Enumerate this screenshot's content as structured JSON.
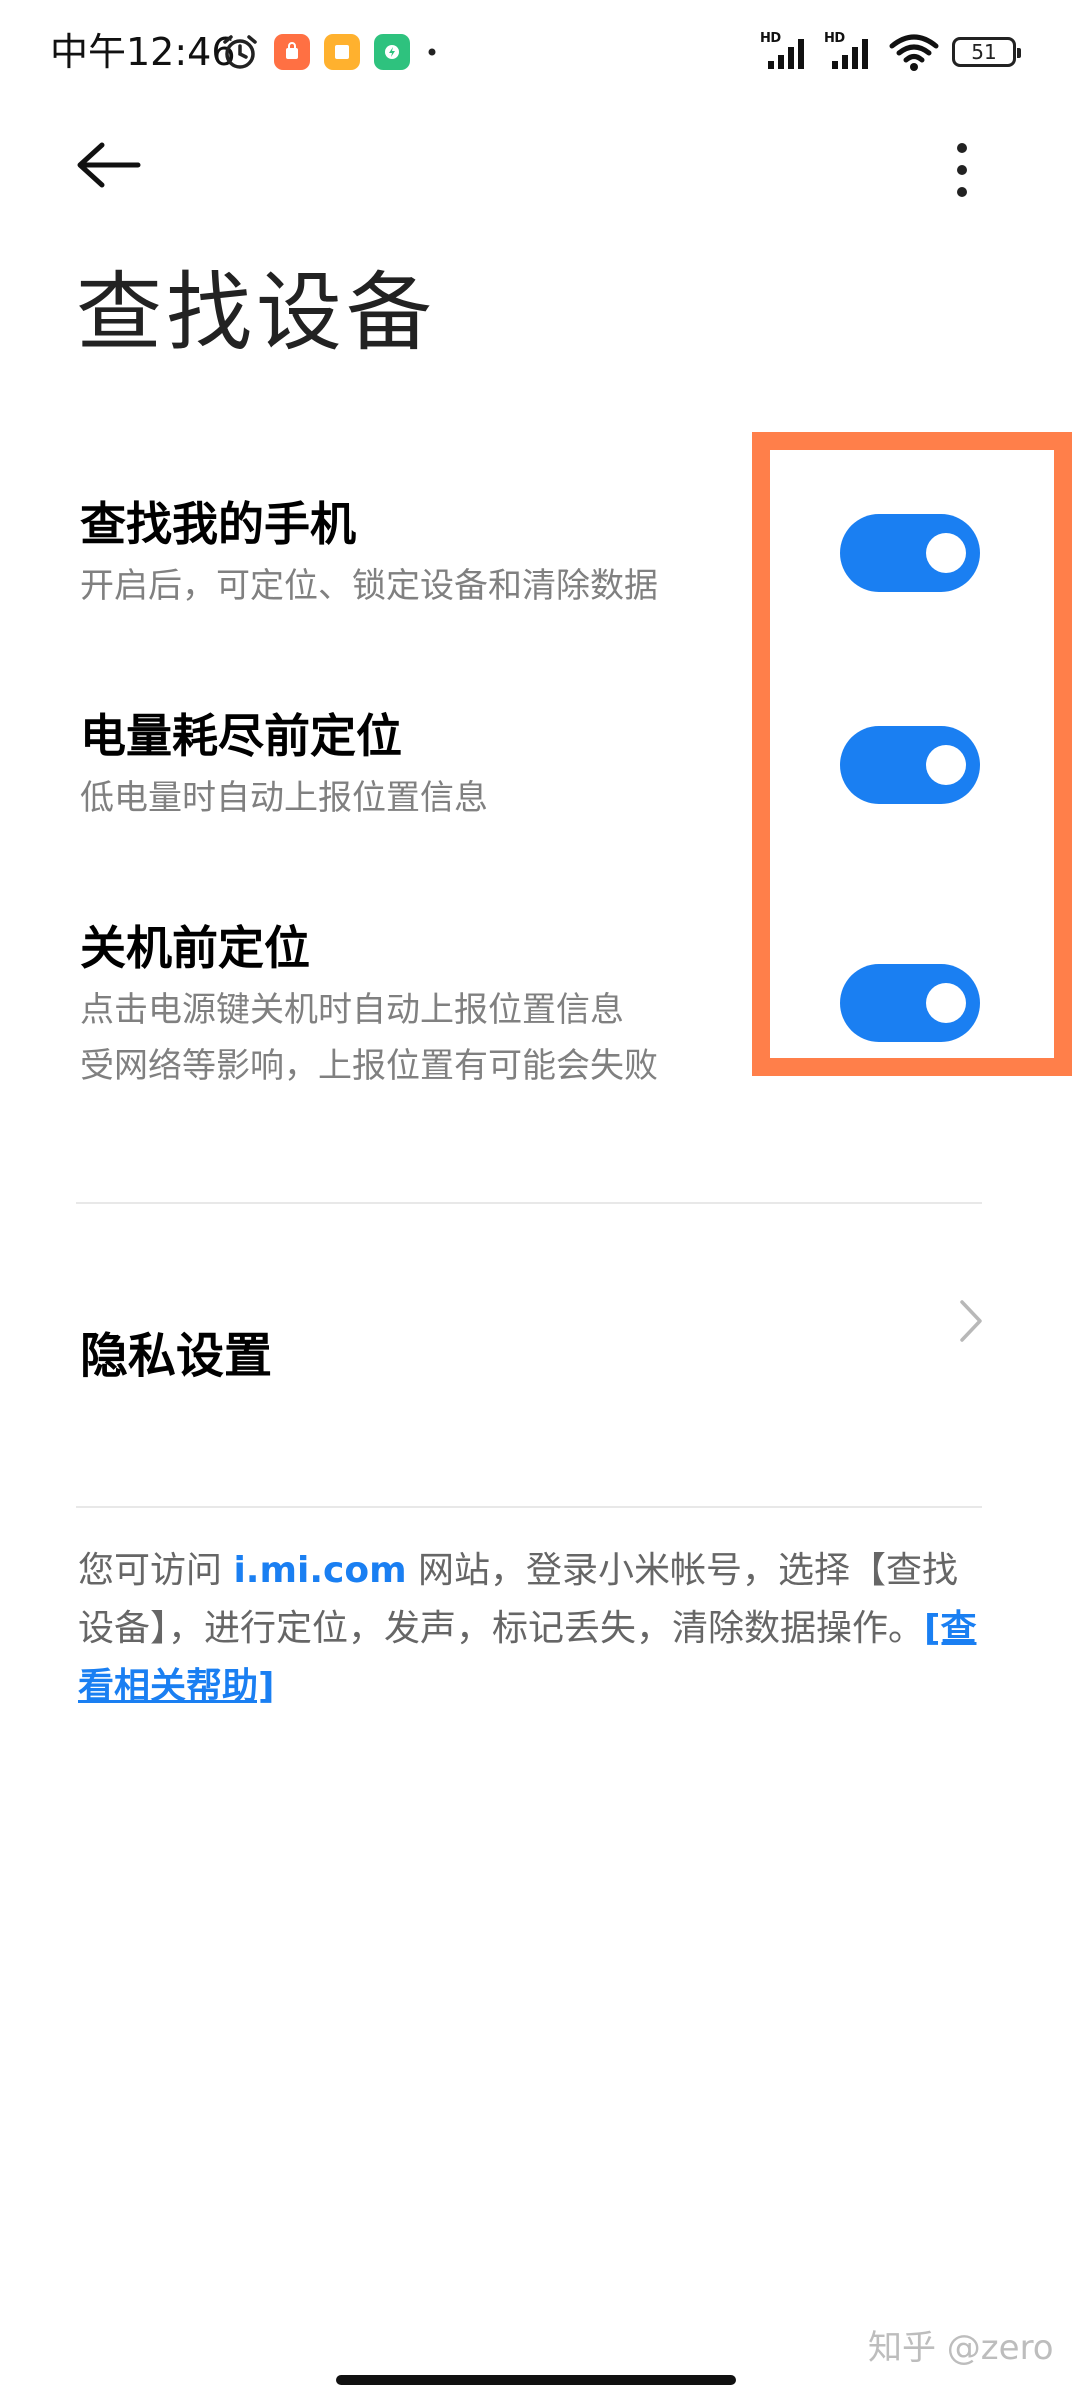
{
  "status_bar": {
    "time": "中午12:46",
    "battery": "51"
  },
  "header": {
    "title": "查找设备"
  },
  "settings": [
    {
      "title": "查找我的手机",
      "desc_lines": [
        "开启后，可定位、锁定设备和清除数据"
      ],
      "enabled": true
    },
    {
      "title": "电量耗尽前定位",
      "desc_lines": [
        "低电量时自动上报位置信息"
      ],
      "enabled": true
    },
    {
      "title": "关机前定位",
      "desc_lines": [
        "点击电源键关机时自动上报位置信息",
        "受网络等影响，上报位置有可能会失败"
      ],
      "enabled": true
    }
  ],
  "privacy": {
    "label": "隐私设置"
  },
  "footer": {
    "prefix": "您可访问 ",
    "site": "i.mi.com",
    "middle": " 网站，登录小米帐号，选择【查找设备】，进行定位，发声，标记丢失，清除数据操作。",
    "help_link": "[查看相关帮助]"
  },
  "watermark": "知乎 @zero",
  "colors": {
    "accent": "#1a7ff2",
    "highlight": "#ff7f4a"
  }
}
